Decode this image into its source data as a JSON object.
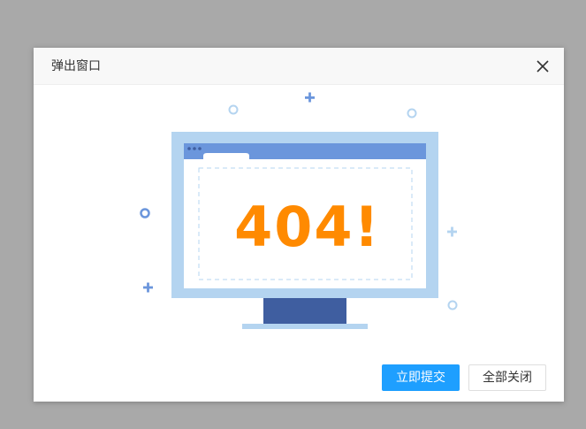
{
  "dialog": {
    "title": "弹出窗口",
    "close_icon": "close-icon",
    "error_text": "404!"
  },
  "buttons": {
    "submit_label": "立即提交",
    "close_all_label": "全部关闭"
  },
  "colors": {
    "error_text": "#ff8a00",
    "monitor_frame": "#b4d4f0",
    "browser_bar": "#6b96dc",
    "monitor_stand": "#3f5ea0",
    "primary_button": "#1e9fff"
  }
}
